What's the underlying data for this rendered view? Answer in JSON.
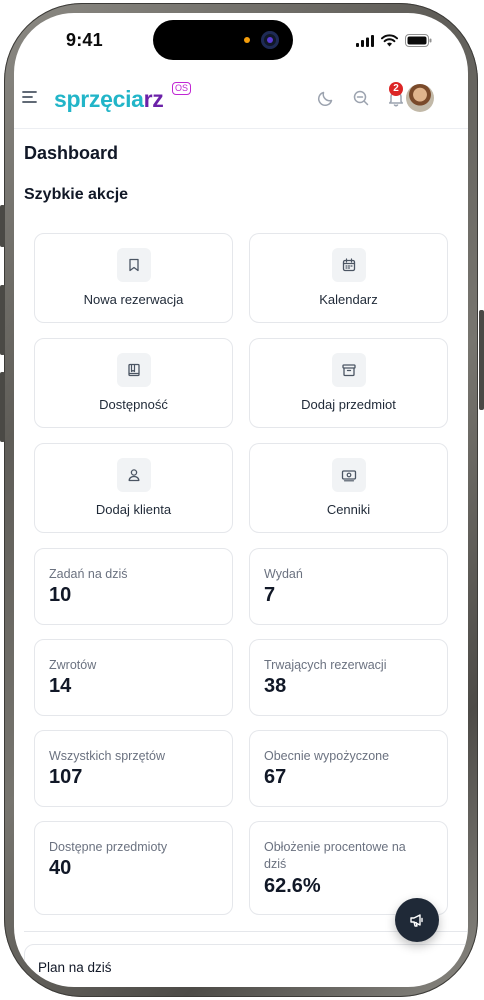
{
  "status_bar": {
    "time": "9:41"
  },
  "header": {
    "logo_main": "sprzęcia",
    "logo_accent": "rz",
    "logo_badge": "OS",
    "notification_count": "2"
  },
  "page": {
    "title": "Dashboard",
    "quick_actions_title": "Szybkie akcje"
  },
  "quick_actions": [
    {
      "label": "Nowa rezerwacja",
      "icon": "bookmark-icon"
    },
    {
      "label": "Kalendarz",
      "icon": "calendar-icon"
    },
    {
      "label": "Dostępność",
      "icon": "book-icon"
    },
    {
      "label": "Dodaj przedmiot",
      "icon": "archive-icon"
    },
    {
      "label": "Dodaj klienta",
      "icon": "user-icon"
    },
    {
      "label": "Cenniki",
      "icon": "banknote-icon"
    }
  ],
  "stats": [
    {
      "label": "Zadań na dziś",
      "value": "10"
    },
    {
      "label": "Wydań",
      "value": "7"
    },
    {
      "label": "Zwrotów",
      "value": "14"
    },
    {
      "label": "Trwających rezerwacji",
      "value": "38"
    },
    {
      "label": "Wszystkich sprzętów",
      "value": "107"
    },
    {
      "label": "Obecnie wypożyczone",
      "value": "67"
    },
    {
      "label": "Dostępne przedmioty",
      "value": "40"
    },
    {
      "label": "Obłożenie procentowe na dziś",
      "value": "62.6%"
    }
  ],
  "plan": {
    "title": "Plan na dziś"
  },
  "colors": {
    "brand_teal": "#22b5c8",
    "brand_purple": "#6b21a8",
    "badge_red": "#dc2626",
    "fab_dark": "#1f2937"
  }
}
